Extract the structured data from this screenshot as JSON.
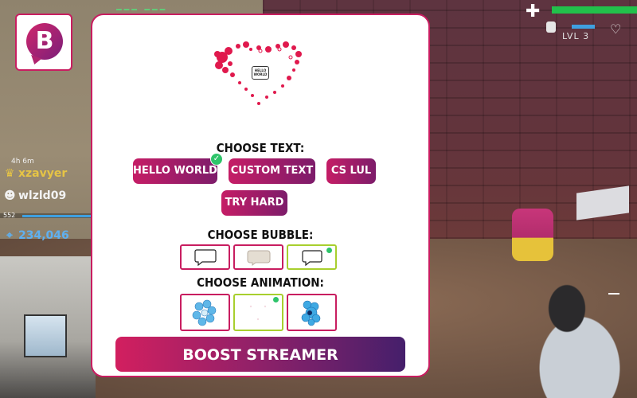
{
  "hud": {
    "level_text": "LVL 3",
    "health_fraction": 1.0,
    "shield_fraction": 0.35
  },
  "stream": {
    "chat_time": "4h 6m",
    "chat_users": [
      {
        "name": "xzavyer",
        "icon": "crown-icon",
        "color": "#e6c445"
      },
      {
        "name": "wlzld09",
        "icon": "skull-icon",
        "color": "#f2f2f2"
      }
    ],
    "xp_value": "552",
    "score_value": "234,046",
    "score_icon": "crosshair-icon"
  },
  "modal": {
    "preview_bubble_text": "HELLO WORLD",
    "text_section_label": "CHOOSE TEXT:",
    "text_options": [
      {
        "label": "HELLO WORLD",
        "selected": true
      },
      {
        "label": "CUSTOM TEXT",
        "selected": false
      },
      {
        "label": "CS LUL",
        "selected": false
      },
      {
        "label": "TRY HARD",
        "selected": false
      }
    ],
    "bubble_section_label": "CHOOSE BUBBLE:",
    "bubble_options": [
      {
        "icon": "speech-bubble-outline-icon",
        "selected": false
      },
      {
        "icon": "speech-bubble-beige-icon",
        "selected": false
      },
      {
        "icon": "speech-bubble-plain-icon",
        "selected": true
      }
    ],
    "animation_section_label": "CHOOSE ANIMATION:",
    "animation_options": [
      {
        "icon": "swirl-blue-animation-icon",
        "selected": false
      },
      {
        "icon": "heart-animation-icon",
        "selected": true
      },
      {
        "icon": "flame-blue-animation-icon",
        "selected": false
      }
    ],
    "boost_button_label": "BOOST STREAMER"
  },
  "colors": {
    "accent": "#c81d60",
    "gradient_start": "#d21f5f",
    "gradient_end": "#451f6b",
    "selected_border": "#a8cf2e",
    "check_green": "#2ec46a"
  }
}
